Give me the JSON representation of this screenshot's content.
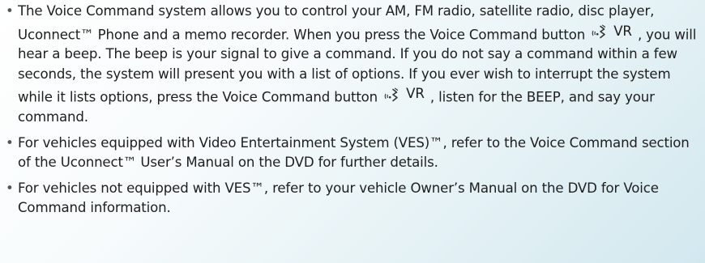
{
  "bullets": [
    {
      "parts": [
        "The Voice Command system allows you to control your AM, FM radio, satellite radio, disc player, Uconnect™ Phone and a memo recorder. When you press the Voice Command button",
        ", you will hear a beep. The beep is your signal to give a command. If you do not say a command within a few seconds, the system will present you with a list of options. If you ever wish to interrupt the system while it lists options, press the Voice Command button",
        ", listen for the BEEP, and say your command."
      ],
      "vr_label": "VR"
    },
    {
      "text": "For vehicles equipped with Video Entertainment System (VES)™, refer to the Voice Command section of the Uconnect™ User’s Manual on the DVD for further details."
    },
    {
      "text": "For vehicles not equipped with VES™, refer to your vehicle Owner’s Manual on the DVD for Voice Command information."
    }
  ],
  "icons": {
    "voice_command": "voice-command-icon",
    "bullet": "•"
  },
  "colors": {
    "text": "#1e1e1e",
    "background_light": "#ffffff",
    "background_tint": "#d2e8ef"
  }
}
